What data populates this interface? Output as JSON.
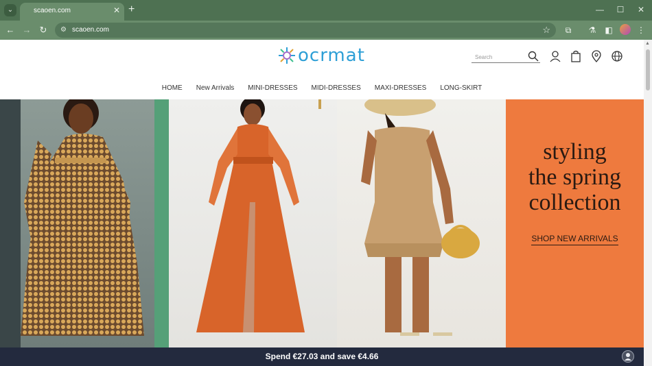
{
  "browser": {
    "tab_title": "scaoen.com",
    "url": "scaoen.com",
    "tab_menu_icon": "chevron-down-icon",
    "new_tab_icon": "plus-icon",
    "close_icon": "close-icon",
    "window_buttons": [
      "minimize-icon",
      "maximize-icon",
      "close-icon"
    ],
    "toolbar_icons": [
      "extensions-icon",
      "labs-icon",
      "side-panel-icon",
      "profile-avatar",
      "menu-icon"
    ]
  },
  "header": {
    "logo_text": "ocrmat",
    "logo_color": "#2d9fd6",
    "search_placeholder": "Search",
    "icons": [
      "account-icon",
      "cart-icon",
      "location-icon",
      "globe-icon"
    ]
  },
  "nav": {
    "items": [
      "HOME",
      "New Arrivals",
      "MINI-DRESSES",
      "MIDI-DRESSES",
      "MAXI-DRESSES",
      "LONG-SKIRT"
    ]
  },
  "hero": {
    "promo_lines": [
      "styling",
      "the spring",
      "collection"
    ],
    "promo_link": "SHOP NEW ARRIVALS",
    "promo_color": "#ee7a3e"
  },
  "banner": {
    "text": "Spend €27.03 and save €4.66"
  }
}
